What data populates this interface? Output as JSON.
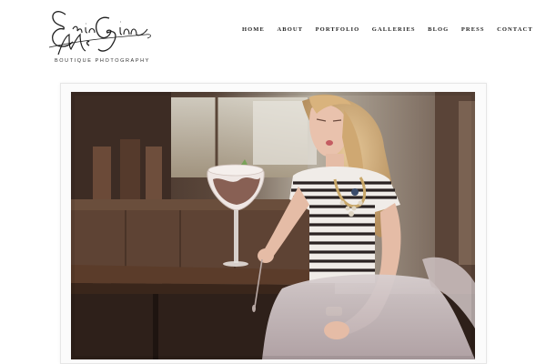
{
  "brand": {
    "script_name": "Erin McGinn",
    "tagline": "BOUTIQUE PHOTOGRAPHY"
  },
  "nav": {
    "items": [
      {
        "label": "HOME"
      },
      {
        "label": "ABOUT"
      },
      {
        "label": "PORTFOLIO"
      },
      {
        "label": "GALLERIES"
      },
      {
        "label": "BLOG"
      },
      {
        "label": "PRESS"
      },
      {
        "label": "CONTACT"
      }
    ]
  },
  "colors": {
    "background": "#ffffff",
    "nav_text": "#222222",
    "frame": "#fbfbfb"
  },
  "hero": {
    "description_icon": "photo-image"
  }
}
